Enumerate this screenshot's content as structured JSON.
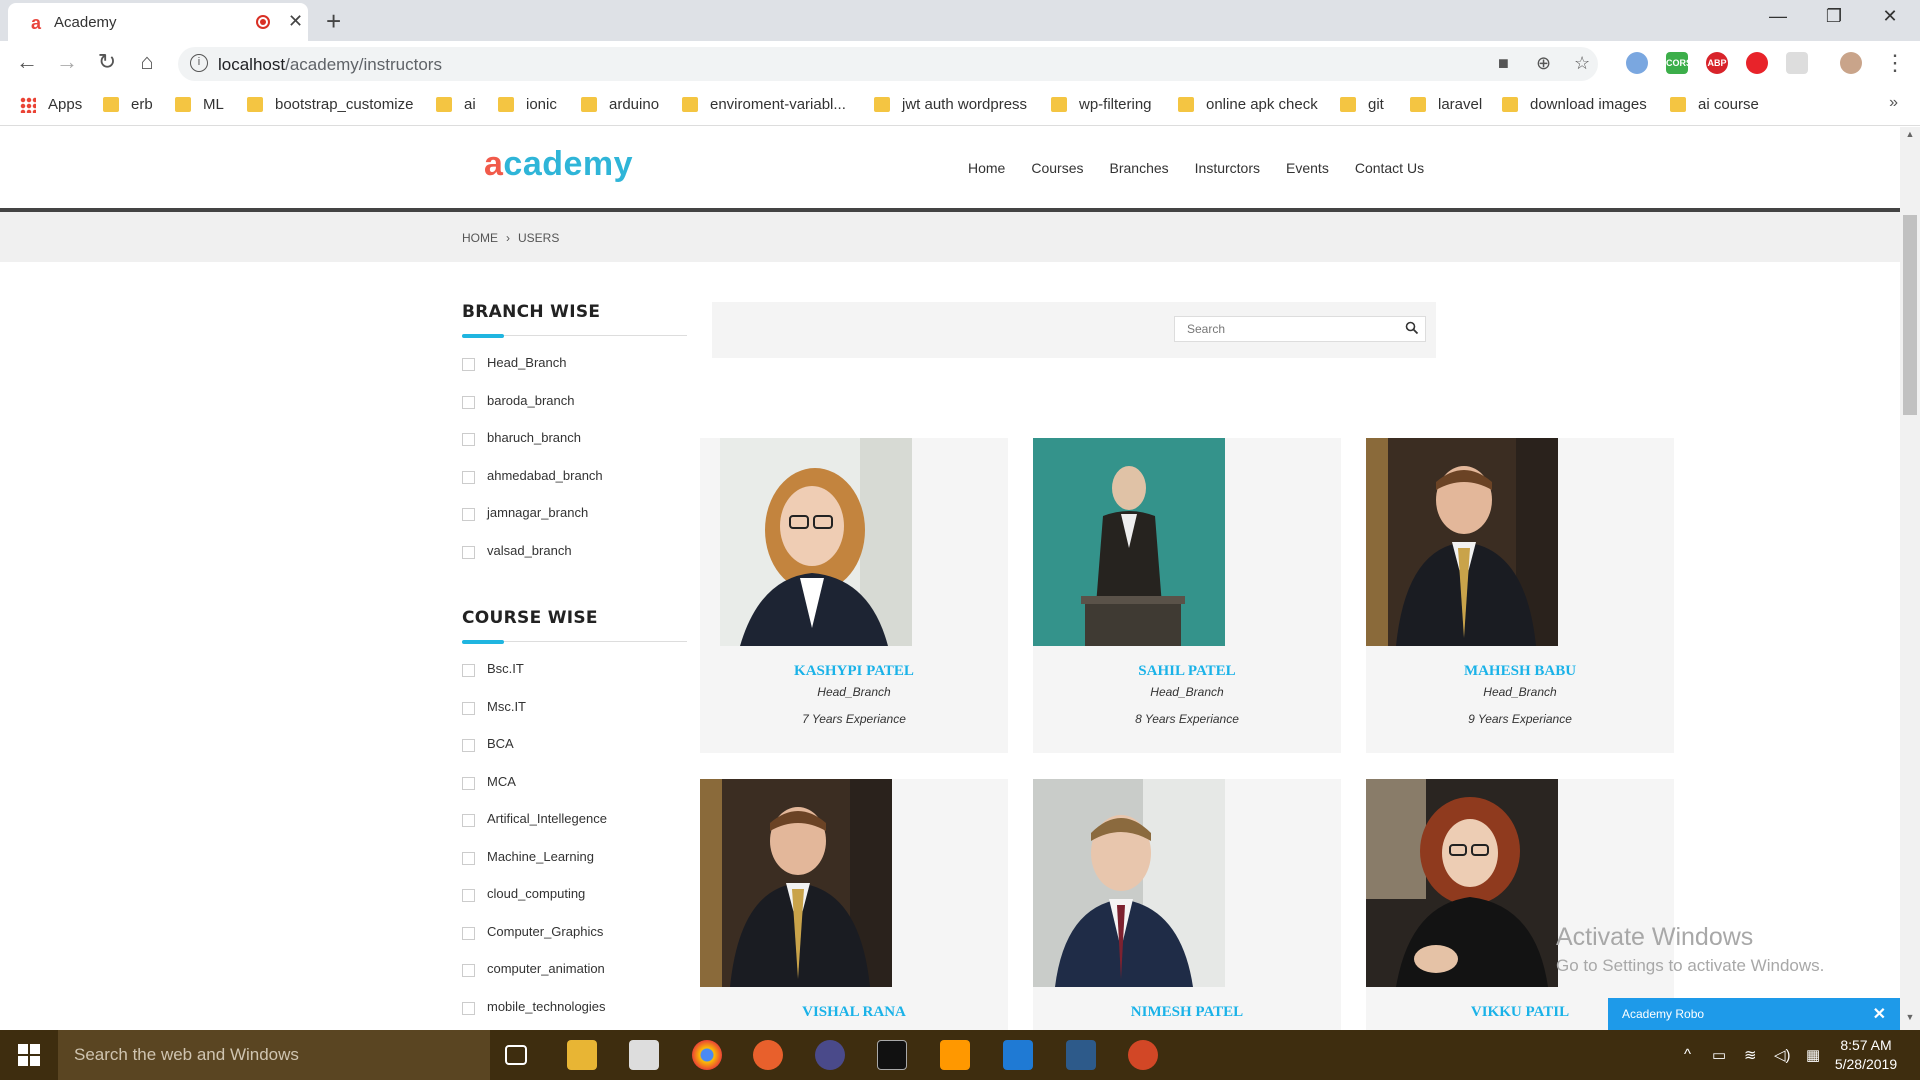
{
  "browser": {
    "tab_title": "Academy",
    "tab_favicon": "a",
    "url_host": "localhost",
    "url_path": "/academy/instructors",
    "bookmarks": [
      {
        "label": "Apps",
        "icon": "apps-grid-icon"
      },
      {
        "label": "erb"
      },
      {
        "label": "ML"
      },
      {
        "label": "bootstrap_customize"
      },
      {
        "label": "ai"
      },
      {
        "label": "ionic"
      },
      {
        "label": "arduino"
      },
      {
        "label": "enviroment-variabl..."
      },
      {
        "label": "jwt auth wordpress"
      },
      {
        "label": "wp-filtering"
      },
      {
        "label": "online apk check"
      },
      {
        "label": "git"
      },
      {
        "label": "laravel"
      },
      {
        "label": "download images"
      },
      {
        "label": "ai course"
      }
    ],
    "extensions": [
      "CORS",
      "ABP"
    ]
  },
  "site": {
    "logo_first": "a",
    "logo_rest": "cademy",
    "nav": [
      "Home",
      "Courses",
      "Branches",
      "Insturctors",
      "Events",
      "Contact Us"
    ],
    "breadcrumb": {
      "home": "HOME",
      "sep": "›",
      "current": "USERS"
    }
  },
  "sidebar": {
    "branch_title": "BRANCH WISE",
    "branches": [
      "Head_Branch",
      "baroda_branch",
      "bharuch_branch",
      "ahmedabad_branch",
      "jamnagar_branch",
      "valsad_branch"
    ],
    "course_title": "COURSE WISE",
    "courses": [
      "Bsc.IT",
      "Msc.IT",
      "BCA",
      "MCA",
      "Artifical_Intellegence",
      "Machine_Learning",
      "cloud_computing",
      "Computer_Graphics",
      "computer_animation",
      "mobile_technologies"
    ]
  },
  "search": {
    "placeholder": "Search"
  },
  "instructors": [
    {
      "name": "KASHYPI PATEL",
      "branch": "Head_Branch",
      "experience": "7 Years Experiance"
    },
    {
      "name": "SAHIL PATEL",
      "branch": "Head_Branch",
      "experience": "8 Years Experiance"
    },
    {
      "name": "MAHESH BABU",
      "branch": "Head_Branch",
      "experience": "9 Years Experiance"
    },
    {
      "name": "VISHAL RANA",
      "branch": "",
      "experience": ""
    },
    {
      "name": "NIMESH PATEL",
      "branch": "",
      "experience": ""
    },
    {
      "name": "VIKKU PATIL",
      "branch": "",
      "experience": ""
    }
  ],
  "overlay": {
    "activate_title": "Activate Windows",
    "activate_sub": "Go to Settings to activate Windows.",
    "chat_title": "Academy Robo",
    "chat_close": "✕"
  },
  "taskbar": {
    "search_placeholder": "Search the web and Windows",
    "time": "8:57 AM",
    "date": "5/28/2019"
  },
  "colors": {
    "accent": "#1ab2e8",
    "logo_red": "#f15a4a",
    "taskbar": "#3e2d0f",
    "chat": "#1e9ae9"
  }
}
